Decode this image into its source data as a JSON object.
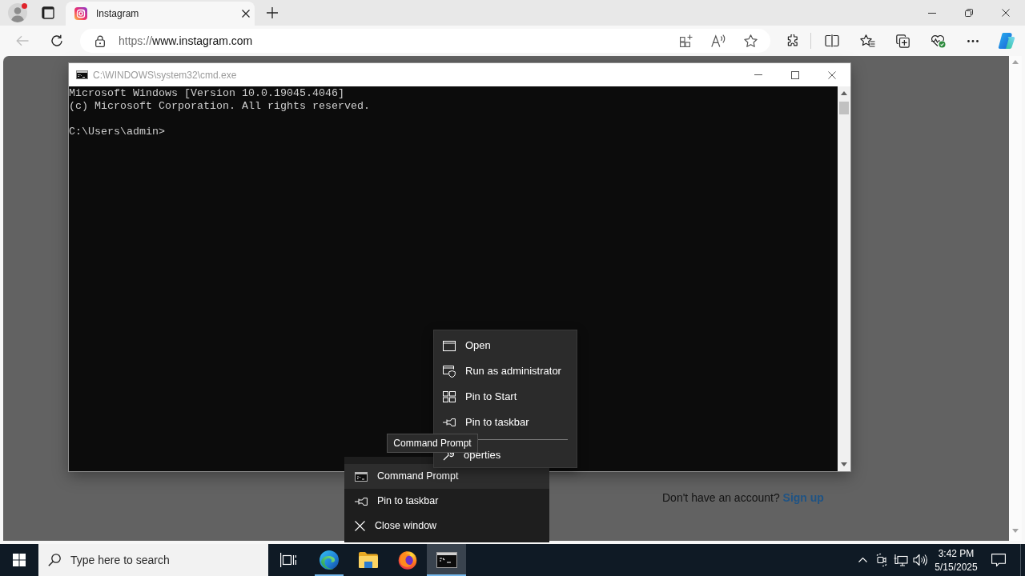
{
  "browser": {
    "profile": {
      "notification": true
    },
    "tabs": [
      {
        "title": "Instagram",
        "selected": true
      }
    ],
    "back_button": {
      "disabled": true
    },
    "address_bar": {
      "scheme": "https://",
      "host": "www.instagram.com"
    }
  },
  "page": {
    "signup_prompt": "Don't have an account?",
    "signup_link": "Sign up"
  },
  "console_window": {
    "title": "C:\\WINDOWS\\system32\\cmd.exe",
    "output_lines": [
      "Microsoft Windows [Version 10.0.19045.4046]",
      "(c) Microsoft Corporation. All rights reserved."
    ],
    "prompt": "C:\\Users\\admin>"
  },
  "context_menu": {
    "items": [
      {
        "kind": "command",
        "label": "Open"
      },
      {
        "kind": "command",
        "label": "Run as administrator"
      },
      {
        "kind": "command",
        "label": "Pin to Start"
      },
      {
        "kind": "command",
        "label": "Pin to taskbar"
      },
      {
        "kind": "separator"
      },
      {
        "kind": "covered",
        "label": "operties"
      }
    ]
  },
  "tooltip": {
    "text": "Command Prompt"
  },
  "jump_list": {
    "items": [
      {
        "label": "Command Prompt",
        "selected": true
      },
      {
        "label": "Pin to taskbar",
        "selected": false
      },
      {
        "label": "Close window",
        "selected": false
      }
    ]
  },
  "taskbar": {
    "search": {
      "placeholder": "Type here to search"
    },
    "apps": [
      {
        "kind": "browser",
        "running": true,
        "selected": false
      },
      {
        "kind": "files",
        "running": false,
        "selected": false
      },
      {
        "kind": "firefox",
        "running": false,
        "selected": false
      },
      {
        "kind": "console",
        "running": true,
        "selected": true
      }
    ],
    "clock": {
      "time": "3:42 PM",
      "date": "5/15/2025"
    }
  }
}
